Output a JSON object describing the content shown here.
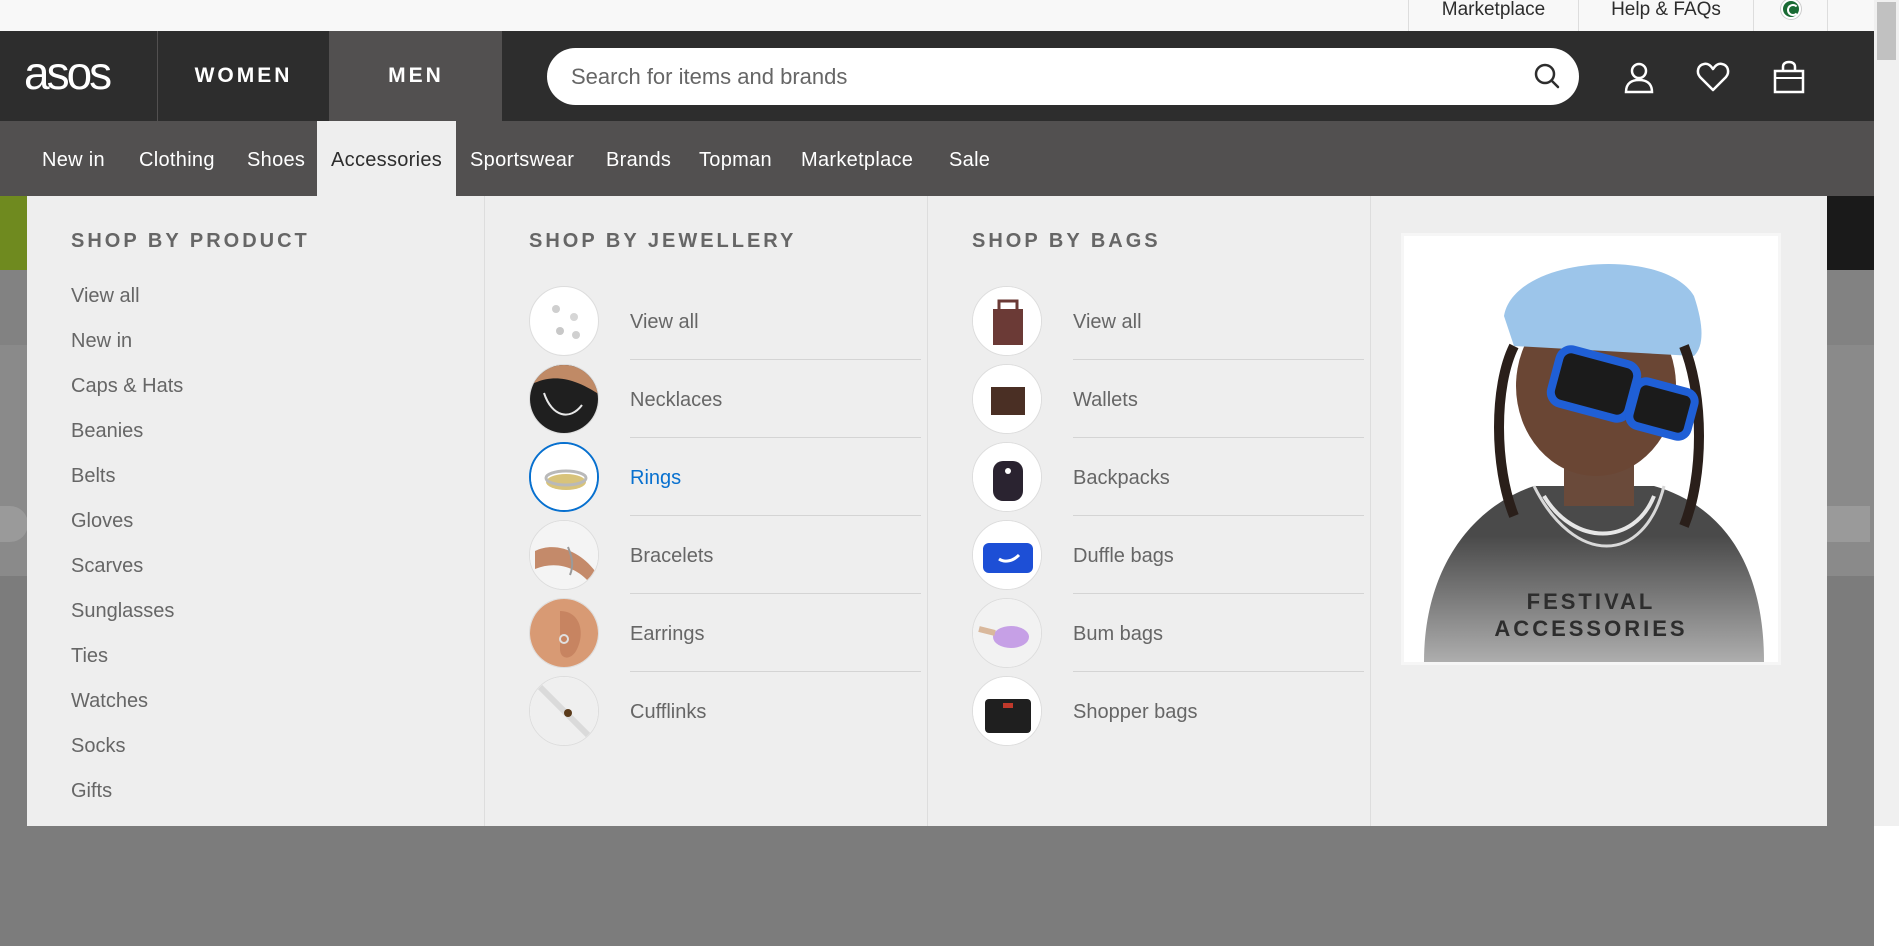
{
  "utility": {
    "links": [
      "Marketplace",
      "Help & FAQs"
    ]
  },
  "header": {
    "logo": "asos",
    "women": "WOMEN",
    "men": "MEN",
    "search_placeholder": "Search for items and brands"
  },
  "nav": {
    "items": [
      "New in",
      "Clothing",
      "Shoes",
      "Accessories",
      "Sportswear",
      "Brands",
      "Topman",
      "Marketplace",
      "Sale"
    ],
    "active": "Accessories"
  },
  "mega": {
    "product": {
      "title": "SHOP BY PRODUCT",
      "items": [
        "View all",
        "New in",
        "Caps & Hats",
        "Beanies",
        "Belts",
        "Gloves",
        "Scarves",
        "Sunglasses",
        "Ties",
        "Watches",
        "Socks",
        "Gifts"
      ]
    },
    "jewellery": {
      "title": "SHOP BY JEWELLERY",
      "items": [
        "View all",
        "Necklaces",
        "Rings",
        "Bracelets",
        "Earrings",
        "Cufflinks"
      ],
      "highlighted": "Rings"
    },
    "bags": {
      "title": "SHOP BY BAGS",
      "items": [
        "View all",
        "Wallets",
        "Backpacks",
        "Duffle bags",
        "Bum bags",
        "Shopper bags"
      ]
    },
    "promo": {
      "line1": "FESTIVAL",
      "line2": "ACCESSORIES"
    }
  },
  "colors": {
    "header_bg": "#2d2d2d",
    "nav_bg": "#525050",
    "menu_bg": "#eeeeee",
    "link_highlight": "#0770cf"
  }
}
